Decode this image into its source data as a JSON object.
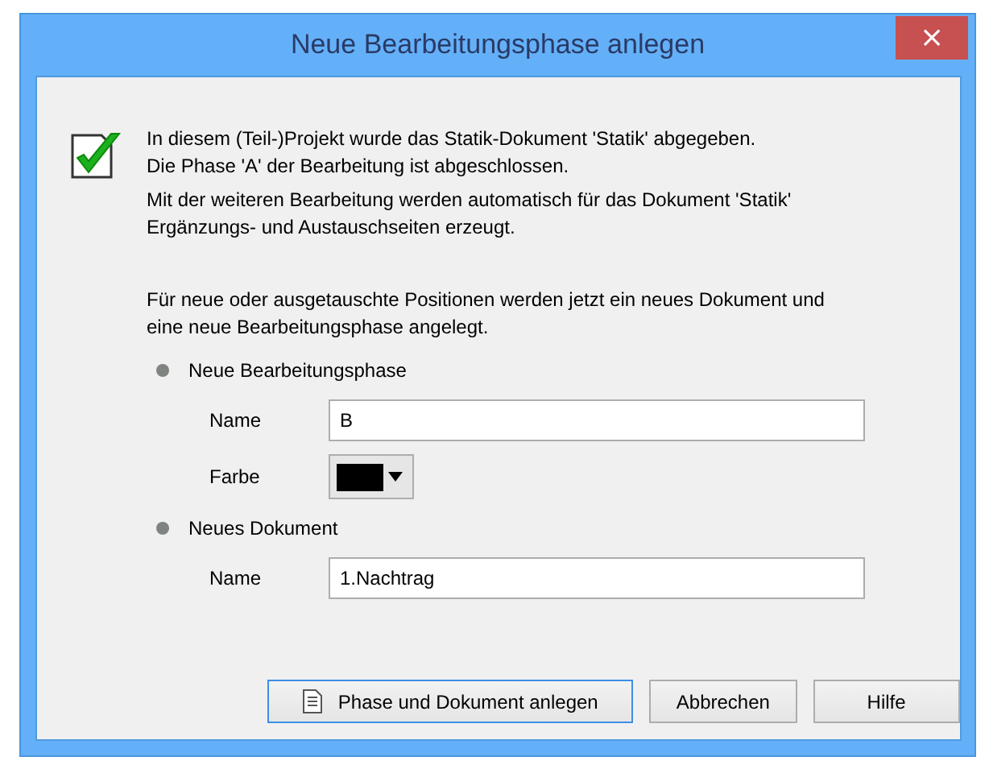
{
  "window": {
    "title": "Neue Bearbeitungsphase anlegen",
    "close": "×"
  },
  "message": {
    "lines": [
      "In diesem (Teil-)Projekt wurde das Statik-Dokument 'Statik' abgegeben.",
      "Die Phase 'A' der Bearbeitung ist abgeschlossen."
    ],
    "detail": [
      "Mit der weiteren Bearbeitung werden automatisch für das Dokument 'Statik'",
      "Ergänzungs- und Austauschseiten erzeugt."
    ]
  },
  "info": [
    "Für neue oder ausgetauschte Positionen werden jetzt ein neues Dokument und",
    "eine neue Bearbeitungsphase angelegt."
  ],
  "sections": [
    {
      "title": "Neue Bearbeitungsphase",
      "fields": [
        {
          "kind": "text",
          "label": "Name",
          "value": "B"
        },
        {
          "kind": "color",
          "label": "Farbe",
          "color": "#000000"
        }
      ]
    },
    {
      "title": "Neues Dokument",
      "fields": [
        {
          "kind": "text",
          "label": "Name",
          "value": "1.Nachtrag"
        }
      ]
    }
  ],
  "buttons": [
    {
      "label": "Phase und Dokument anlegen",
      "default": true,
      "icon": true
    },
    {
      "label": "Abbrechen",
      "default": false,
      "icon": false
    },
    {
      "label": "Hilfe",
      "default": false,
      "icon": false
    }
  ]
}
